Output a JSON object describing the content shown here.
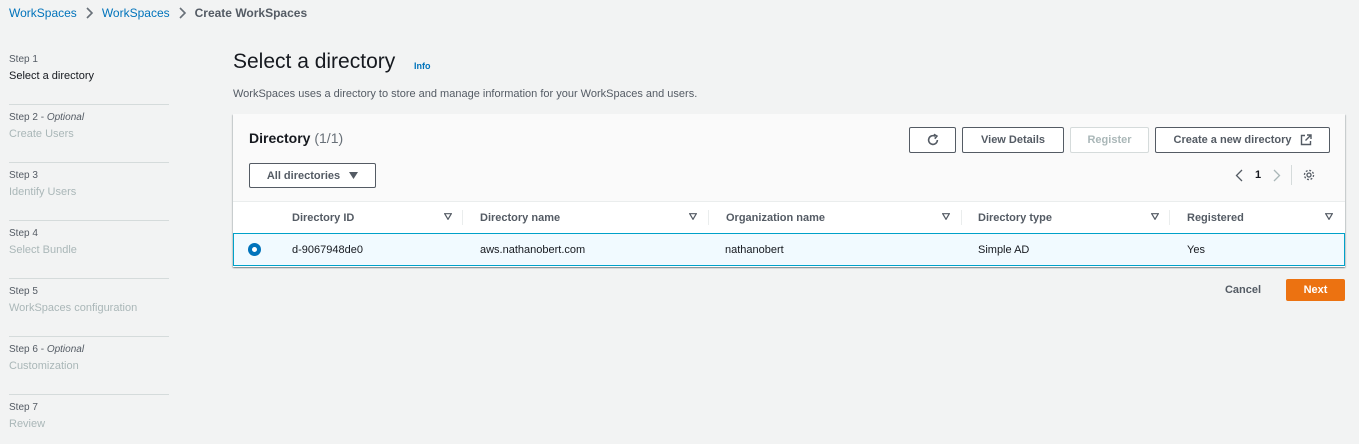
{
  "breadcrumb": {
    "items": [
      "WorkSpaces",
      "WorkSpaces"
    ],
    "current": "Create WorkSpaces"
  },
  "steps": [
    {
      "number": "Step 1",
      "optional": "",
      "title": "Select a directory",
      "active": true
    },
    {
      "number": "Step 2 - ",
      "optional": "Optional",
      "title": "Create Users",
      "active": false
    },
    {
      "number": "Step 3",
      "optional": "",
      "title": "Identify Users",
      "active": false
    },
    {
      "number": "Step 4",
      "optional": "",
      "title": "Select Bundle",
      "active": false
    },
    {
      "number": "Step 5",
      "optional": "",
      "title": "WorkSpaces configuration",
      "active": false
    },
    {
      "number": "Step 6 - ",
      "optional": "Optional",
      "title": "Customization",
      "active": false
    },
    {
      "number": "Step 7",
      "optional": "",
      "title": "Review",
      "active": false
    }
  ],
  "page": {
    "title": "Select a directory",
    "info": "Info",
    "description": "WorkSpaces uses a directory to store and manage information for your WorkSpaces and users."
  },
  "directory": {
    "title": "Directory",
    "count": "(1/1)",
    "buttons": {
      "view_details": "View Details",
      "register": "Register",
      "create": "Create a new directory"
    },
    "filter": "All directories",
    "pager": {
      "page": "1"
    },
    "columns": [
      "Directory ID",
      "Directory name",
      "Organization name",
      "Directory type",
      "Registered"
    ],
    "rows": [
      {
        "id": "d-9067948de0",
        "name": "aws.nathanobert.com",
        "org": "nathanobert",
        "type": "Simple AD",
        "registered": "Yes",
        "selected": true
      }
    ]
  },
  "actions": {
    "cancel": "Cancel",
    "next": "Next"
  },
  "colors": {
    "link": "#0073bb",
    "primary": "#ec7211",
    "selected_row_bg": "#f1faff",
    "selected_row_border": "#00a1c9"
  },
  "icons": [
    "chevron-right-icon",
    "refresh-icon",
    "external-link-icon",
    "caret-down-icon",
    "chevron-left-icon",
    "settings-icon",
    "sort-icon"
  ]
}
